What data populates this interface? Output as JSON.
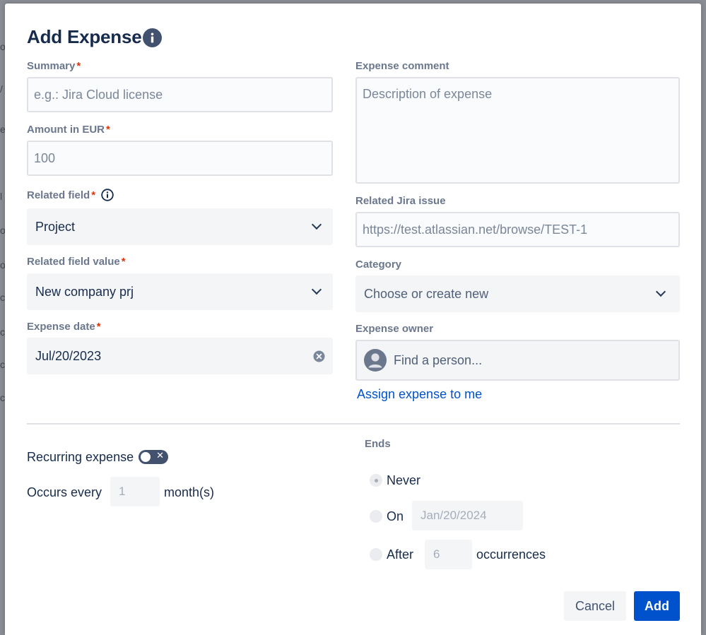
{
  "dialog": {
    "title": "Add Expense"
  },
  "form": {
    "summary": {
      "label": "Summary",
      "required_mark": "*",
      "placeholder": "e.g.: Jira Cloud license"
    },
    "amount": {
      "label": "Amount in EUR",
      "required_mark": "*",
      "placeholder": "100"
    },
    "related_field": {
      "label": "Related field",
      "required_mark": "*",
      "value": "Project"
    },
    "related_field_value": {
      "label": "Related field value",
      "required_mark": "*",
      "value": "New company prj"
    },
    "expense_date": {
      "label": "Expense date",
      "required_mark": "*",
      "value": "Jul/20/2023"
    },
    "expense_comment": {
      "label": "Expense comment",
      "placeholder": "Description of expense"
    },
    "related_jira_issue": {
      "label": "Related Jira issue",
      "placeholder": "https://test.atlassian.net/browse/TEST-1"
    },
    "category": {
      "label": "Category",
      "placeholder": "Choose or create new"
    },
    "expense_owner": {
      "label": "Expense owner",
      "placeholder": "Find a person...",
      "assign_link": "Assign expense to me"
    }
  },
  "recurring": {
    "label": "Recurring expense",
    "enabled": false,
    "toggle_mark": "✕",
    "occurs_label": "Occurs every",
    "occurs_placeholder": "1",
    "unit_label": "month(s)"
  },
  "ends": {
    "label": "Ends",
    "options": [
      {
        "label": "Never",
        "selected": true
      },
      {
        "label": "On",
        "placeholder": "Jan/20/2024"
      },
      {
        "label": "After",
        "placeholder": "6",
        "suffix": "occurrences"
      }
    ]
  },
  "actions": {
    "cancel_label": "Cancel",
    "add_label": "Add"
  },
  "backdrop_glyphs": [
    "o",
    "/",
    "e",
    "l",
    "o",
    "o",
    "c",
    "c",
    "c",
    "c"
  ],
  "colors": {
    "primary": "#0052cc",
    "link": "#0052cc",
    "required": "#de350b",
    "label": "#6b778c",
    "text": "#172b4d"
  }
}
